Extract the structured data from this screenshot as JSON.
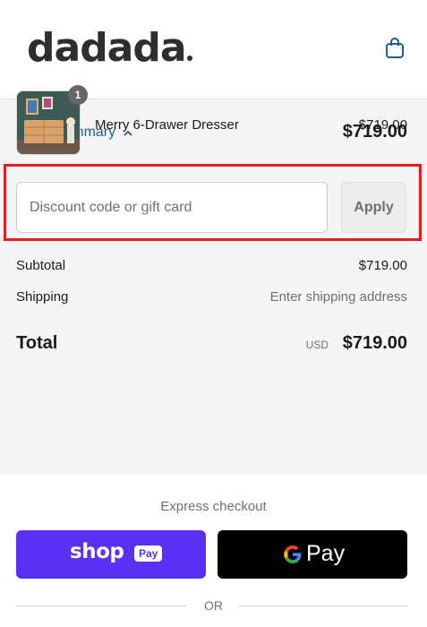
{
  "header": {
    "logo_text": "dadada",
    "cart_icon": "shopping-bag-icon"
  },
  "summary": {
    "toggle_label": "Order summary",
    "toggle_icon": "chevron-up-icon",
    "total": "$719.00"
  },
  "product": {
    "name": "Merry 6-Drawer Dresser",
    "price": "$719.00",
    "quantity": "1"
  },
  "discount": {
    "placeholder": "Discount code or gift card",
    "value": "",
    "apply_label": "Apply"
  },
  "totals": {
    "subtotal_label": "Subtotal",
    "subtotal_value": "$719.00",
    "shipping_label": "Shipping",
    "shipping_value": "Enter shipping address",
    "total_label": "Total",
    "currency": "USD",
    "total_value": "$719.00"
  },
  "express": {
    "label": "Express checkout",
    "shop_pay_text": "shop",
    "shop_pay_badge": "Pay",
    "gpay_text": "Pay"
  },
  "divider": {
    "or_text": "OR"
  },
  "colors": {
    "link": "#1f5f8b",
    "shop_pay": "#5a31f4",
    "highlight": "#e11d1d"
  }
}
